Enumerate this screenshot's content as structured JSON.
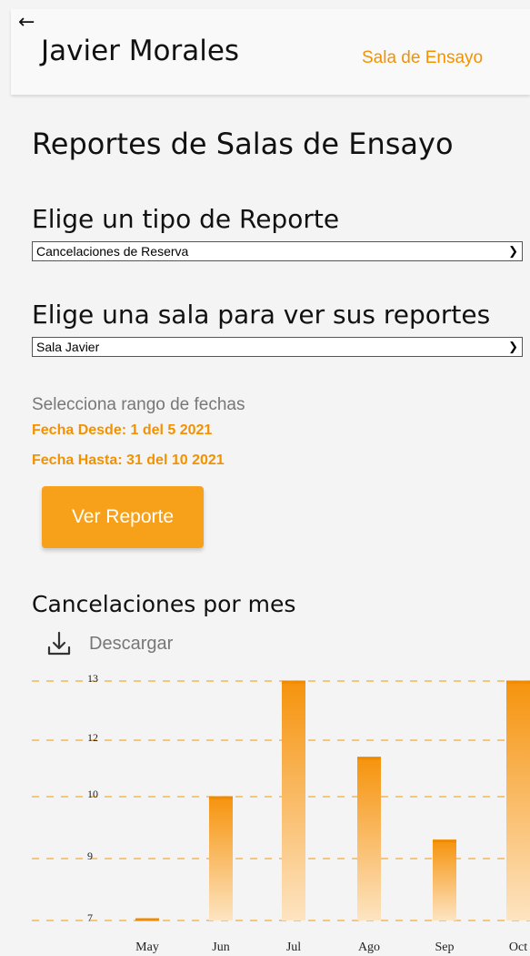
{
  "header": {
    "back_icon": "arrow-left-icon",
    "user_name": "Javier Morales",
    "nav_link": "Sala de Ensayo"
  },
  "page": {
    "title": "Reportes de Salas de Ensayo"
  },
  "report_type": {
    "label": "Elige un tipo de Reporte",
    "selected": "Cancelaciones de Reserva"
  },
  "room": {
    "label": "Elige una sala para ver sus reportes",
    "selected": "Sala Javier"
  },
  "dates": {
    "hint": "Selecciona rango de fechas",
    "from": "Fecha Desde: 1 del 5 2021",
    "to": "Fecha Hasta: 31 del 10 2021"
  },
  "actions": {
    "view_report": "Ver Reporte",
    "download": "Descargar",
    "download_icon": "download-icon"
  },
  "colors": {
    "accent": "#f29200",
    "button": "#f7a11a"
  },
  "chart_data": {
    "type": "bar",
    "title": "Cancelaciones por mes",
    "categories": [
      "May",
      "Jun",
      "Jul",
      "Ago",
      "Sep",
      "Oct"
    ],
    "values": [
      7,
      10,
      13,
      11.4,
      9.3,
      13
    ],
    "yticks": [
      7,
      9,
      10,
      12,
      13
    ],
    "grid": true,
    "legend": "none"
  }
}
